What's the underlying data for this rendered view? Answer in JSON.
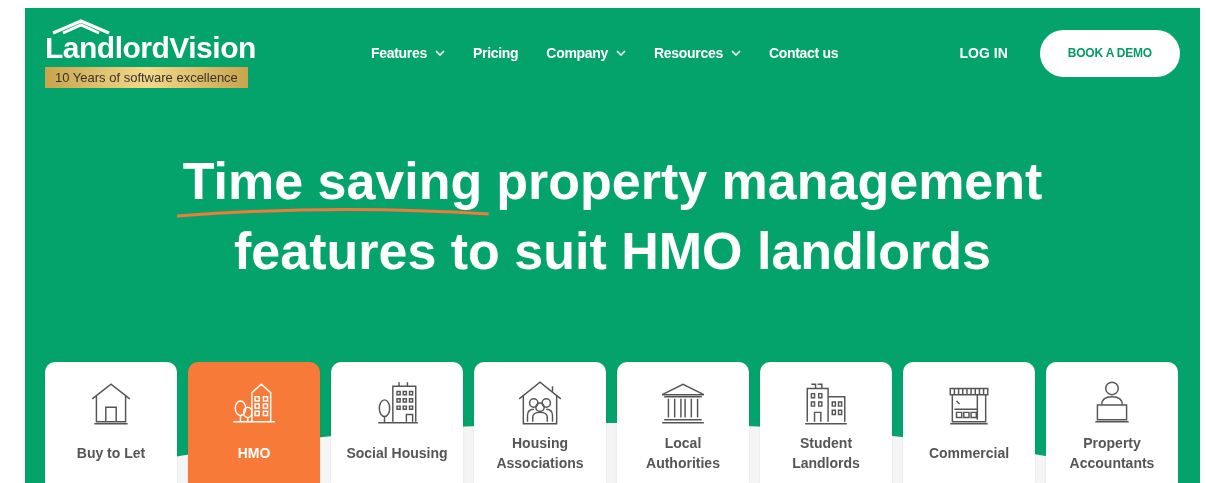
{
  "logo": {
    "name": "LandlordVision",
    "tagline": "10 Years of software excellence"
  },
  "nav": [
    {
      "label": "Features",
      "dropdown": true
    },
    {
      "label": "Pricing",
      "dropdown": false
    },
    {
      "label": "Company",
      "dropdown": true
    },
    {
      "label": "Resources",
      "dropdown": true
    },
    {
      "label": "Contact us",
      "dropdown": false
    }
  ],
  "login": "LOG IN",
  "demo_button": "BOOK A DEMO",
  "headline": {
    "highlight": "Time saving",
    "rest": "property management",
    "line2": "features to suit HMO landlords"
  },
  "categories": [
    {
      "kind": "house",
      "label": "Buy to Let",
      "selected": false
    },
    {
      "kind": "hmo",
      "label": "HMO",
      "selected": true
    },
    {
      "kind": "apartments",
      "label": "Social Housing",
      "selected": false
    },
    {
      "kind": "family",
      "label": "Housing Associations",
      "selected": false
    },
    {
      "kind": "government",
      "label": "Local Authorities",
      "selected": false
    },
    {
      "kind": "student",
      "label": "Student Landlords",
      "selected": false
    },
    {
      "kind": "shop",
      "label": "Commercial",
      "selected": false
    },
    {
      "kind": "accountant",
      "label": "Property Accountants",
      "selected": false
    }
  ]
}
